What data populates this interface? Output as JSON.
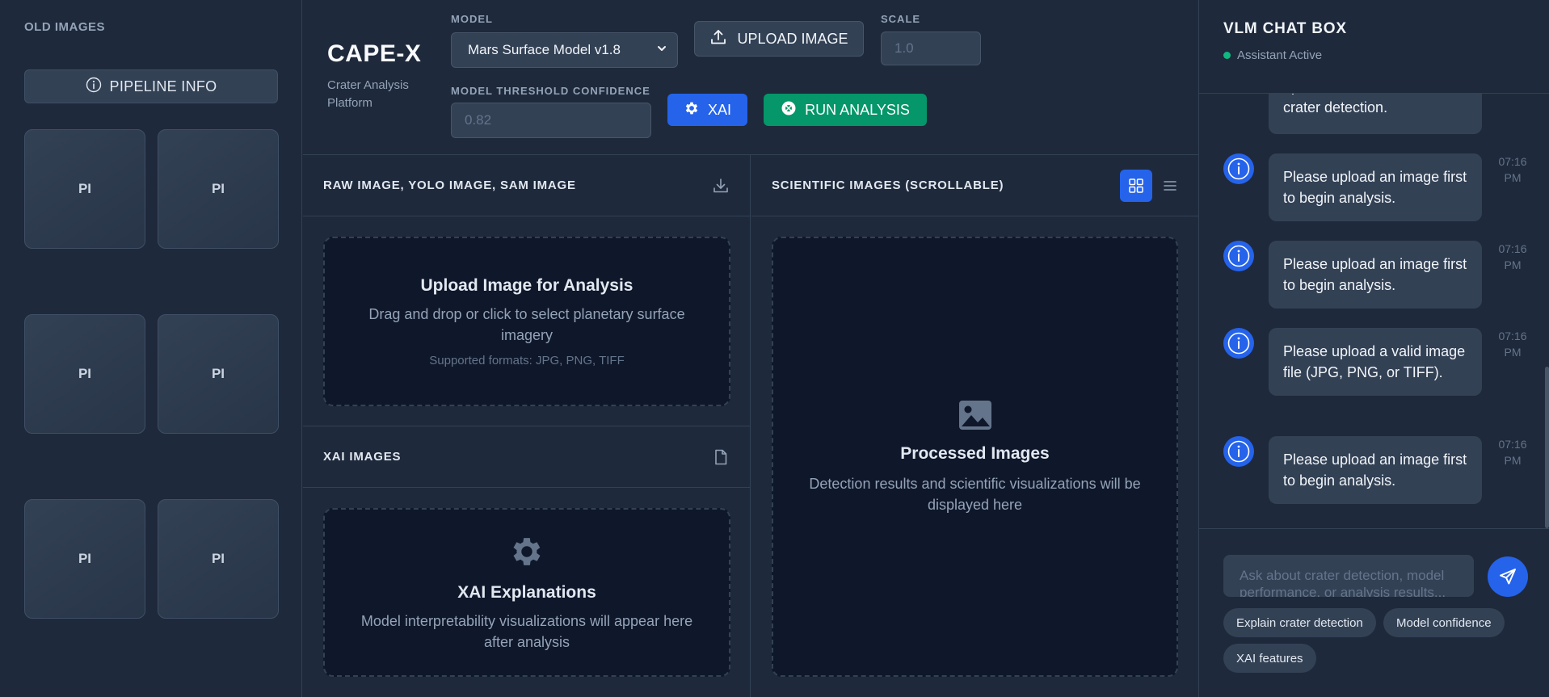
{
  "sidebar": {
    "title": "OLD IMAGES",
    "pipeline_button": "PIPELINE INFO",
    "thumbnails": [
      "PI",
      "PI",
      "PI",
      "PI",
      "PI",
      "PI"
    ]
  },
  "header": {
    "brand": "CAPE-X",
    "brand_subtitle": "Crater Analysis Platform",
    "model_label": "MODEL",
    "model_value": "Mars Surface Model v1.8",
    "upload_button": "UPLOAD IMAGE",
    "scale_label": "SCALE",
    "scale_placeholder": "1.0",
    "threshold_label": "MODEL THRESHOLD CONFIDENCE",
    "threshold_placeholder": "0.82",
    "xai_button": "XAI",
    "run_button": "RUN ANALYSIS"
  },
  "raw_panel": {
    "title": "RAW IMAGE, YOLO IMAGE, SAM IMAGE",
    "dropzone_title": "Upload Image for Analysis",
    "dropzone_text": "Drag and drop or click to select planetary surface imagery",
    "dropzone_formats": "Supported formats: JPG, PNG, TIFF"
  },
  "xai_panel": {
    "title": "XAI IMAGES",
    "dropzone_title": "XAI Explanations",
    "dropzone_text": "Model interpretability visualizations will appear here after analysis"
  },
  "sci_panel": {
    "title": "SCIENTIFIC IMAGES (SCROLLABLE)",
    "dropzone_title": "Processed Images",
    "dropzone_text": "Detection results and scientific visualizations will be displayed here"
  },
  "chat": {
    "title": "VLM CHAT BOX",
    "status": "Assistant Active",
    "partial_message": "optimized for Martian terrain crater detection.",
    "messages": [
      {
        "text": "Please upload an image first to begin analysis.",
        "time": "07:16 PM"
      },
      {
        "text": "Please upload an image first to begin analysis.",
        "time": "07:16 PM"
      },
      {
        "text": "Please upload a valid image file (JPG, PNG, or TIFF).",
        "time": "07:16 PM"
      },
      {
        "text": "Please upload an image first to begin analysis.",
        "time": "07:16 PM"
      }
    ],
    "input_placeholder": "Ask about crater detection, model performance, or analysis results...",
    "suggestions": [
      "Explain crater detection",
      "Model confidence",
      "XAI features"
    ]
  },
  "colors": {
    "background": "#1e293b",
    "panel_dark": "#0f172a",
    "accent_blue": "#2563eb",
    "accent_green": "#059669",
    "status_green": "#10b981"
  }
}
